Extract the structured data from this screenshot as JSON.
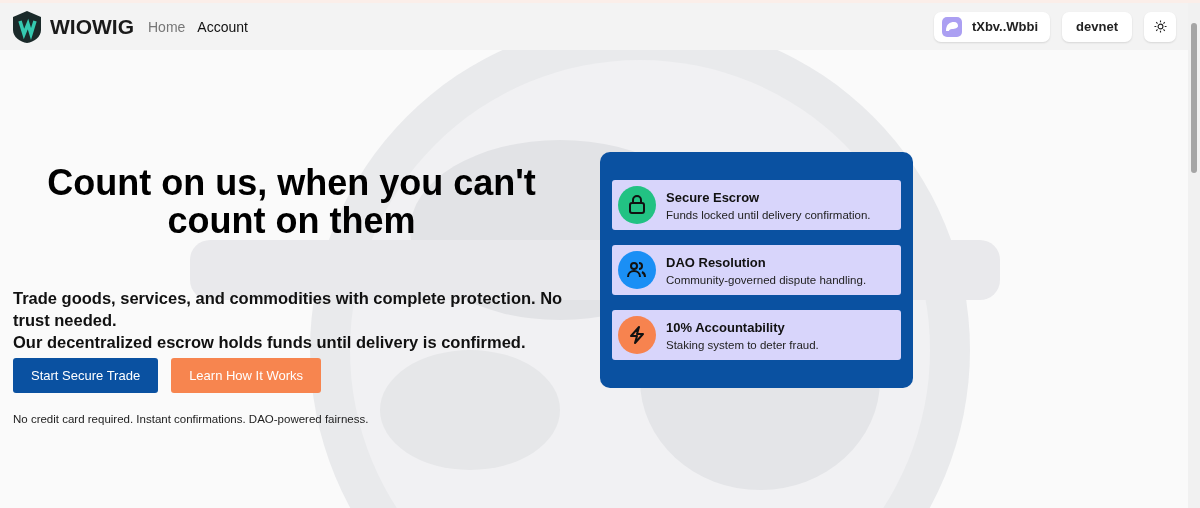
{
  "header": {
    "brand": "WIOWIG",
    "nav": [
      {
        "label": "Home",
        "selected": false
      },
      {
        "label": "Account",
        "selected": true
      }
    ],
    "wallet": "tXbv..Wbbi",
    "network": "devnet"
  },
  "hero": {
    "headline": "Count on us, when you can't count on them",
    "lead": [
      "Trade goods, services, and commodities with complete protection. No trust needed.",
      "Our decentralized escrow holds funds until delivery is confirmed."
    ],
    "buttons": [
      {
        "label": "Start Secure Trade",
        "kind": "primary"
      },
      {
        "label": "Learn How It Works",
        "kind": "secondary"
      }
    ],
    "note": "No credit card required. Instant confirmations. DAO-powered fairness."
  },
  "features": [
    {
      "kind": "lock",
      "color": "#22c283",
      "title": "Secure Escrow",
      "text": "Funds locked until delivery confirmation."
    },
    {
      "kind": "users",
      "color": "#1a8ff5",
      "title": "DAO Resolution",
      "text": "Community-governed dispute handling."
    },
    {
      "kind": "bolt",
      "color": "#f7834f",
      "title": "10% Accountability",
      "text": "Staking system to deter fraud."
    }
  ]
}
